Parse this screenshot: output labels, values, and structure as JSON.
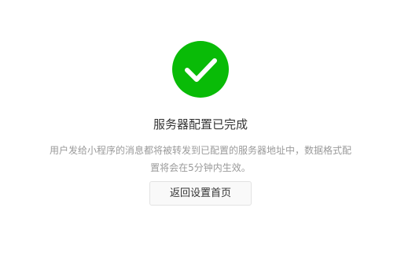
{
  "status": {
    "icon": "check-circle-icon",
    "color": "#09bb07"
  },
  "result": {
    "title": "服务器配置已完成",
    "description_line1": "用户发给小程序的消息都将被转发到已配置的服务器地址中，数据格式配",
    "description_line2": "置将会在5分钟内生效。"
  },
  "actions": {
    "back_label": "返回设置首页"
  }
}
